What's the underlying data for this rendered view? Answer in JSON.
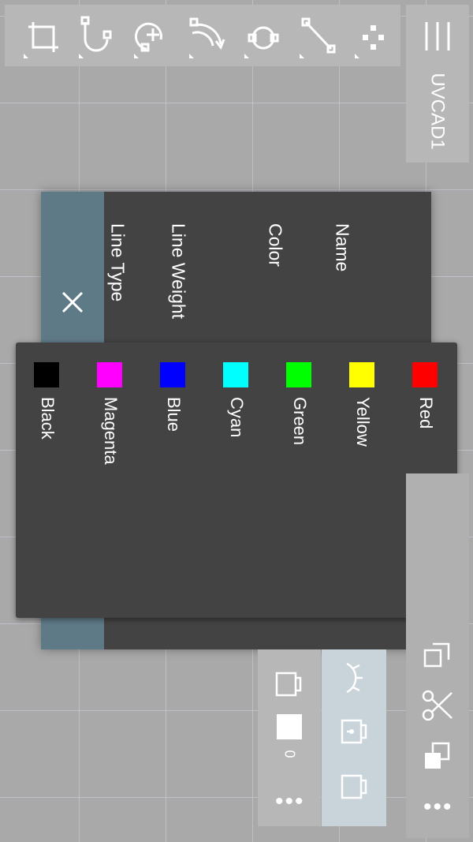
{
  "app": {
    "title": "UVCAD1"
  },
  "toolbar": {
    "tools": [
      "rectangle-tool-icon",
      "polyline-arc-tool-icon",
      "add-point-tool-icon",
      "rotate-tool-icon",
      "circle-tool-icon",
      "line-tool-icon",
      "points-tool-icon"
    ]
  },
  "properties": {
    "labels": [
      "Line Type",
      "Line Weight",
      "Color",
      "Name"
    ]
  },
  "colors": [
    {
      "name": "Black",
      "hex": "#000000"
    },
    {
      "name": "Magenta",
      "hex": "#ff00ff"
    },
    {
      "name": "Blue",
      "hex": "#0000ff"
    },
    {
      "name": "Cyan",
      "hex": "#00ffff"
    },
    {
      "name": "Green",
      "hex": "#00ff00"
    },
    {
      "name": "Yellow",
      "hex": "#ffff00"
    },
    {
      "name": "Red",
      "hex": "#ff0000"
    }
  ],
  "layer": {
    "number": "0",
    "more": "•••"
  },
  "edit": {
    "more": "•••"
  },
  "theme": {
    "panel": "#434343",
    "accent_strip": "#5f7a87",
    "toolbar": "#b7b7b7"
  }
}
